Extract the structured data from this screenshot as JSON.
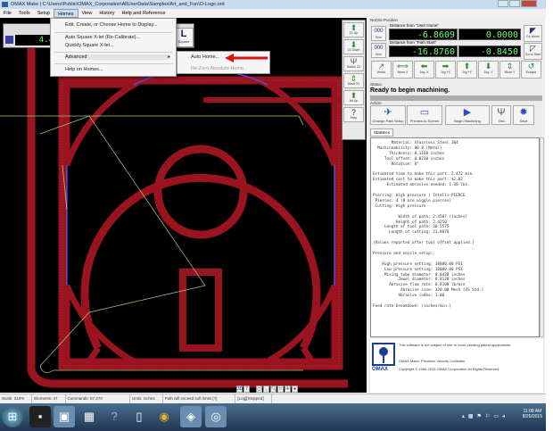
{
  "window": {
    "title": "OMAX Make | C:\\Users\\Public\\OMAX_Corporation\\AllUserData\\Samples\\Art_and_Fun\\O-Logo.ord"
  },
  "menubar": [
    "File",
    "Tools",
    "Setup",
    "Homes",
    "View",
    "History",
    "Help and Reference"
  ],
  "homes_menu": {
    "items": [
      "Edit, Create, or Choose Home to Display...",
      "Auto Square X-let (Re-Calibrate)...",
      "Quickly Square X-let...",
      "Advanced",
      "Help on Homes..."
    ],
    "submenu": [
      "Auto Home...",
      "Re-Zero Absolute Home..."
    ]
  },
  "left_readout": {
    "value": "4.4"
  },
  "square_button": {
    "label": "Square"
  },
  "vertical_toolbar": [
    {
      "label": "Z1 Up",
      "icon": "arrow-up-icon"
    },
    {
      "label": "Z1 Down",
      "icon": "arrow-down-icon"
    },
    {
      "label": "Switch Z1",
      "icon": "tool-icon"
    },
    {
      "label": "Move Z1",
      "icon": "move-vertical-icon"
    },
    {
      "label": "Ad Up",
      "icon": "arrow-up-icon"
    },
    {
      "label": "Help",
      "icon": "help-icon"
    }
  ],
  "nozzle": {
    "title": "Nozzle Position",
    "user_home_label": "Distance from \"User Home\"",
    "path_start_label": "Distance from \"Path Start\"",
    "user_home_x": "-6.8609",
    "user_home_y": "0.0000",
    "path_start_x": "-16.8760",
    "path_start_y": "-0.8450",
    "zero_label": "Zero",
    "go_home": "Go Home",
    "go_to_start": "Go to Start",
    "jog": [
      {
        "label": "Vector",
        "icon": "vector-icon"
      },
      {
        "label": "Move X",
        "icon": "move-horizontal-icon"
      },
      {
        "label": "Jog -X",
        "icon": "arrow-left-icon"
      },
      {
        "label": "Jog +X",
        "icon": "arrow-right-icon"
      },
      {
        "label": "Jog +Y",
        "icon": "arrow-up-icon"
      },
      {
        "label": "Jog -Y",
        "icon": "arrow-down-icon"
      },
      {
        "label": "Move Y",
        "icon": "move-vertical-icon"
      },
      {
        "label": "Escape",
        "icon": "escape-icon"
      }
    ]
  },
  "status": {
    "title": "Status",
    "text": "Ready to begin machining."
  },
  "action": {
    "title": "Action",
    "buttons": [
      {
        "label": "Change Path Setup",
        "icon": "path-setup-icon"
      },
      {
        "label": "Preview to Screen",
        "icon": "monitor-icon"
      },
      {
        "label": "Begin Machining",
        "icon": "play-icon"
      },
      {
        "label": "Test",
        "icon": "test-icon"
      },
      {
        "label": "Save",
        "icon": "gear-icon"
      }
    ]
  },
  "statistics": {
    "tab": "Statistics",
    "lines": [
      "        Material: Stainless Steel 304",
      "  Machineability: 80.0 (Metal)",
      "       Thickness: 0.1160 inches",
      "     Tool offset: 0.0210 inches",
      "        Rotation: 0°",
      "",
      "Estimated time to make this part: 2.472 min.",
      "Estimated cost to make this part: $2.02",
      "      Estimated abrasive needed: 1.38 lbs.",
      "",
      "Piercing: High pressure | Intelli-PIERCE",
      " Pierces: 4 (0 are wiggle pierces)",
      " Cutting: High pressure",
      "",
      "           Width of path: 2.4507 (inches)",
      "          Height of path: 2.4250",
      "     Length of tool path: 30.5575",
      "       Length of cutting: 21.8076",
      "",
      "(Values reported after tool offset applied.)",
      "",
      "Pressure and nozzle setup:",
      "",
      "    High pressure setting: 38000.00 PSI",
      "     Low pressure setting: 18000.00 PSI",
      "     Mixing tube diameter: 0.0430 inches",
      "           Jewel diameter: 0.0120 inches",
      "       Abrasive flow rate: 0.8100 lb/min",
      "            Abrasive size: 120.00 Mesh (US Std.)",
      "           Abrasive index: 1.00",
      "",
      "Feed rate breakdown: (inches/min.)"
    ]
  },
  "about": {
    "line1": "This software is the subject of one or more pending patent applications.",
    "line2": "OMAX Make: Precision Velocity Controller",
    "line3": "Copyright © 1990-2015 OMAX Corporation All Rights Reserved",
    "logo": "OMAX"
  },
  "statusbar": [
    "Scale: 315%",
    "Elements: 47",
    "Commands: 67,270",
    "Units: inches",
    "Path will exceed soft limits [?]",
    "[Log][Stopped]"
  ],
  "taskbar": {
    "time": "11:08 AM",
    "date": "8/26/2015"
  },
  "colors": {
    "path_red": "#9a1420",
    "lead_green": "#a7c97a",
    "arc_blue": "#5a4ad0",
    "readout_green": "#55ff55",
    "arrow": "#e01010"
  }
}
